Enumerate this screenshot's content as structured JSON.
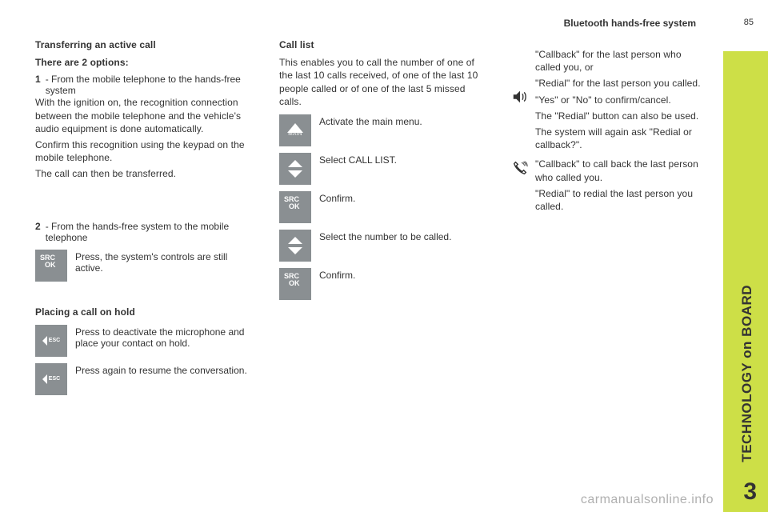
{
  "header": "Bluetooth hands-free system",
  "page_number": "85",
  "sidebar": {
    "section": "TECHNOLOGY on BOARD",
    "chapter": "3"
  },
  "col1": {
    "h1": "Transferring an active call",
    "options_intro": "There are 2 options:",
    "opt1_num": "1",
    "opt1_text": "- From the mobile telephone to the hands-free system",
    "para1": "With the ignition on, the recognition connection between the mobile telephone and the vehicle's audio equipment is done automatically.",
    "para2": "Confirm this recognition using the keypad on the mobile telephone.",
    "para3": "The call can then be transferred.",
    "opt2_num": "2",
    "opt2_text": "- From the hands-free system to the mobile telephone",
    "opt2_action": "Press, the system's controls are still active.",
    "h2": "Placing a call on hold",
    "hold1": "Press to deactivate the microphone and place your contact on hold.",
    "hold2": "Press again to resume the conversation."
  },
  "col2": {
    "h1": "Call list",
    "intro": "This enables you to call the number of one of the last 10 calls received, of one of the last 10 people called or of one of the last 5 missed calls.",
    "step1": "Activate the main menu.",
    "step2": "Select CALL LIST.",
    "step3": "Confirm.",
    "step4": "Select the number to be called.",
    "step5": "Confirm."
  },
  "col3": {
    "block1_a": "\"Callback\" for the last person who called you, or",
    "block1_b": "\"Redial\" for the last person you called.",
    "block1_c": "\"Yes\" or \"No\" to confirm/cancel.",
    "block1_d": "The \"Redial\" button can also be used.",
    "block1_e": "The system will again ask \"Redial or callback?\".",
    "block2_a": "\"Callback\" to call back the last person who called you.",
    "block2_b": "\"Redial\" to redial the last person you called."
  },
  "icons": {
    "main_label": "MAIN",
    "src": "SRC",
    "ok": "OK",
    "esc": "ESC"
  },
  "watermark": "carmanualsonline.info"
}
